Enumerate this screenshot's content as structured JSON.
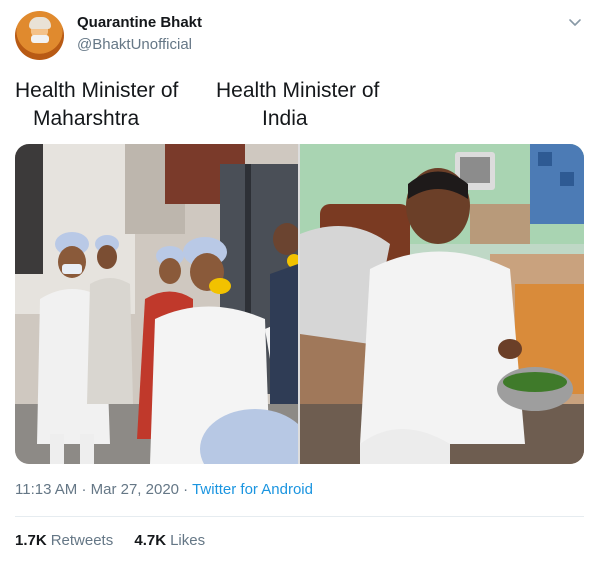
{
  "author": {
    "display_name": "Quarantine Bhakt",
    "handle": "@BhaktUnofficial",
    "avatar_icon": "avatar-photo"
  },
  "tweet": {
    "caption_left_line1": "Health Minister of",
    "caption_left_line2": "Maharshtra",
    "caption_right_line1": "Health Minister of",
    "caption_right_line2": "India",
    "menu_icon": "chevron-down-icon"
  },
  "meta": {
    "time": "11:13 AM",
    "date": "Mar 27, 2020",
    "separator": "·",
    "source": "Twitter for Android"
  },
  "stats": {
    "retweets_count": "1.7K",
    "retweets_label": "Retweets",
    "likes_count": "4.7K",
    "likes_label": "Likes"
  },
  "colors": {
    "link": "#1b95e0",
    "secondary_text": "#657786",
    "primary_text": "#14171a"
  }
}
